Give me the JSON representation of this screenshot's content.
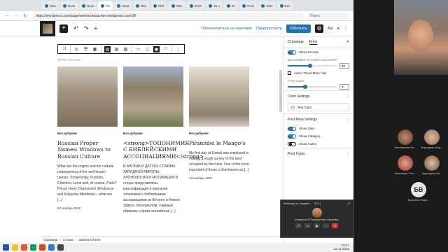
{
  "browser": {
    "tabs": [
      {
        "label": "Мои"
      },
      {
        "label": "Russ"
      },
      {
        "label": "Russ"
      },
      {
        "label": "Пo",
        "active": true
      },
      {
        "label": "Запи"
      },
      {
        "label": "Вво"
      },
      {
        "label": "WW"
      },
      {
        "label": "Wee"
      },
      {
        "label": "2022"
      },
      {
        "label": "15 л"
      },
      {
        "label": "Ко"
      },
      {
        "label": "Поис"
      },
      {
        "label": "Wee"
      },
      {
        "label": "Без"
      }
    ],
    "url": "https://wordpress.com/page/worterundsachen.wordpress.com/36",
    "search_placeholder": "Поиск"
  },
  "editor_toolbar": {
    "add_icon": "+",
    "undo_icon": "↶",
    "redo_icon": "↷",
    "list_icon": "≡",
    "switch_draft": "Переключиться на черновик",
    "preview": "Предпросмотр",
    "update": "Обновить",
    "gear_icon": "⚙",
    "styles_icon": "Aa",
    "jetpack_icon": "●",
    "more_icon": "⋮"
  },
  "canvas": {
    "write_header_placeholder": "Write header...",
    "posts": [
      {
        "category": "Без рубрики",
        "title": "Russian Proper Names: Windows to Russian Culture",
        "excerpt": "What are the origins and the cultural underpinning of the well-known names: Tchaikovsky, Pushkin, Chekhov, Lenin and, of course, Putin? Prince Harry Charlsovich Windzorov and Katyusha Middleton – what are [...]",
        "date": "23 Ноябрь 2022"
      },
      {
        "category": "Без рубрики",
        "title": "<strong>ТОПОНИМИЯ С БИБЛЕЙСКИМИ АССОЦИАЦИЯМИ</strong>",
        "excerpt": "В АНГЛИИ И ДРУГИХ СТРАНАХ ЗАПАДНОЙ ЕВРОПЫ: ХРОНОЛОГИЯ И МОТИВАЦИЯ В статье представлены классификация и описание топонимов с библейскими ассоциациями из Ветхого и Нового Завета. Материалом, главным образом, служит английская [...]",
        "date": ""
      },
      {
        "category": "Без рубрики",
        "title": "Piramidei le Maago'o",
        "excerpt": "My first day at Uxmal was employed in making a rough survey of the land occupied by the ruins. One of the most important of these is that known as [...]",
        "date": "23 Ноябрь 2022"
      }
    ]
  },
  "breadcrumb": [
    "Страница",
    "Строка",
    "Записи в блоге"
  ],
  "sidebar": {
    "tab_page": "Страница",
    "tab_block": "Блок",
    "close_icon": "✕",
    "show_excerpt": "Show Excerpt",
    "max_words_label": "MAX NUMBER OF WORDS IN EXCERPT",
    "max_words_value": "30",
    "read_more_label": "Add a \"Read More\" link",
    "type_scale_label": "TYPE SCALE",
    "type_scale_value": "3",
    "color_settings": "Color Settings",
    "text_color": "Text Color",
    "post_meta_settings": "Post Meta Settings",
    "show_date": "Show Date",
    "show_category": "Show Category",
    "show_author": "Show Author",
    "post_types": "Post Types",
    "dots_icon": "⋮"
  },
  "webinar": {
    "title": "Вебинар по создани...",
    "timer": "30:11",
    "user": "Исмаилов Ю Расширенные настройки"
  },
  "taskbar": {
    "time": "20:27",
    "date": "23.11.2022"
  },
  "participants": [
    {
      "name": "Милованова Ле..."
    },
    {
      "name": "Бородавко Люд..."
    },
    {
      "name": "Королёнко Оль..."
    },
    {
      "name": "Карандина Ва..."
    },
    {
      "name": "Бусыгина Мари...",
      "initials": "БВ"
    }
  ]
}
